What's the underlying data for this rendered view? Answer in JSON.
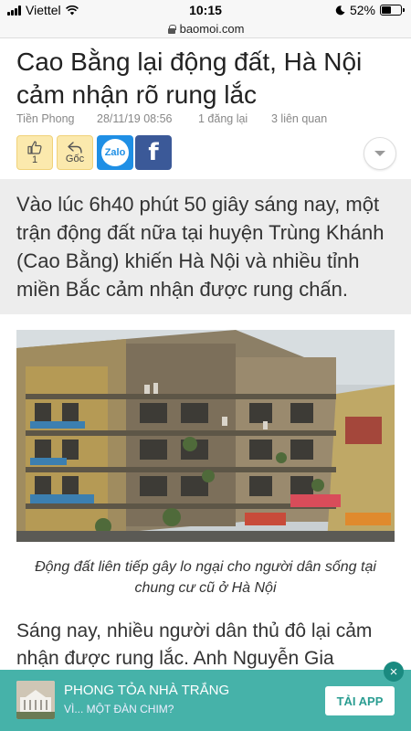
{
  "status_bar": {
    "carrier": "Viettel",
    "time": "10:15",
    "battery": "52%",
    "battery_level": 0.52
  },
  "browser": {
    "url": "baomoi.com"
  },
  "article": {
    "headline": "Cao Bằng lại động đất, Hà Nội cảm nhận rõ rung lắc",
    "source": "Tiền Phong",
    "datetime": "28/11/19 08:56",
    "reposts": "1 đăng lại",
    "related": "3 liên quan",
    "sapo": "Vào lúc 6h40 phút 50 giây sáng nay, một trận động đất nữa tại huyện Trùng Khánh (Cao Bằng) khiến Hà Nội và nhiều tỉnh miền Bắc cảm nhận được rung chấn.",
    "caption": "Động đất liên tiếp gây lo ngại cho người dân sống tại chung cư cũ ở Hà Nội",
    "body_text": "Sáng nay, nhiều người dân thủ đô lại cảm nhận được rung lắc. Anh Nguyễn Gia"
  },
  "actions": {
    "like_count": "1",
    "origin_label": "Gốc",
    "zalo_label": "Zalo",
    "facebook_label": "f"
  },
  "ad": {
    "title": "PHONG TỎA NHÀ TRẮNG",
    "subtitle": "VÌ... MỘT ĐÀN CHIM?",
    "button": "TẢI APP",
    "close": "×"
  },
  "icons": {
    "like": "thumbs-up-icon",
    "origin": "reply-arrow-icon",
    "dropdown": "chevron-down-icon",
    "lock": "lock-icon",
    "wifi": "wifi-icon",
    "moon": "moon-icon"
  },
  "colors": {
    "ad_banner": "#32aaa0",
    "action_yellow": "#fbe9ad",
    "zalo_blue": "#1f8fe5",
    "facebook_blue": "#3b5998",
    "sapo_background": "#ededed"
  }
}
